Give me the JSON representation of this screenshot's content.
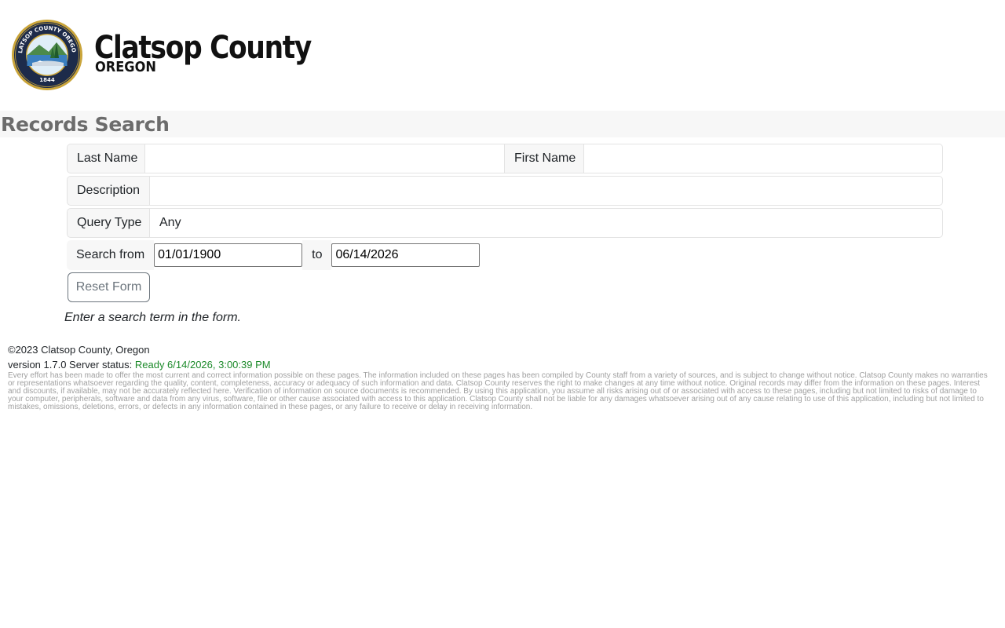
{
  "header": {
    "logo_icon": "clatsop-county-seal",
    "seal_text_top": "CLATSOP COUNTY OREGON",
    "seal_year": "1844",
    "brand_name": "Clatsop County",
    "brand_sub": "OREGON"
  },
  "page": {
    "title": "Records Search"
  },
  "form": {
    "last_name_label": "Last Name",
    "last_name_value": "",
    "first_name_label": "First Name",
    "first_name_value": "",
    "description_label": "Description",
    "description_value": "",
    "query_type_label": "Query Type",
    "query_type_value": "Any",
    "search_from_label": "Search from",
    "date_from": "01/01/1900",
    "to_label": "to",
    "date_to": "06/14/2026",
    "reset_label": "Reset Form",
    "hint": "Enter a search term in the form."
  },
  "footer": {
    "copyright": "©2023 Clatsop County, Oregon",
    "version_text": "version 1.7.0 Server status: ",
    "status_text": "Ready 6/14/2026, 3:00:39 PM",
    "status_color": "#1c8a2a",
    "disclaimer": "Every effort has been made to offer the most current and correct information possible on these pages. The information included on these pages has been compiled by County staff from a variety of sources, and is subject to change without notice. Clatsop County makes no warranties or representations whatsoever regarding the quality, content, completeness, accuracy or adequacy of such information and data. Clatsop County reserves the right to make changes at any time without notice. Original records may differ from the information on these pages. Interest and discounts, if available, may not be accurately reflected here. Verification of information on source documents is recommended. By using this application, you assume all risks arising out of or associated with access to these pages, including but not limited to risks of damage to your computer, peripherals, software and data from any virus, software, file or other cause associated with access to this application. Clatsop County shall not be liable for any damages whatsoever arising out of any cause relating to use of this application, including but not limited to mistakes, omissions, deletions, errors, or defects in any information contained in these pages, or any failure to receive or delay in receiving information."
  }
}
